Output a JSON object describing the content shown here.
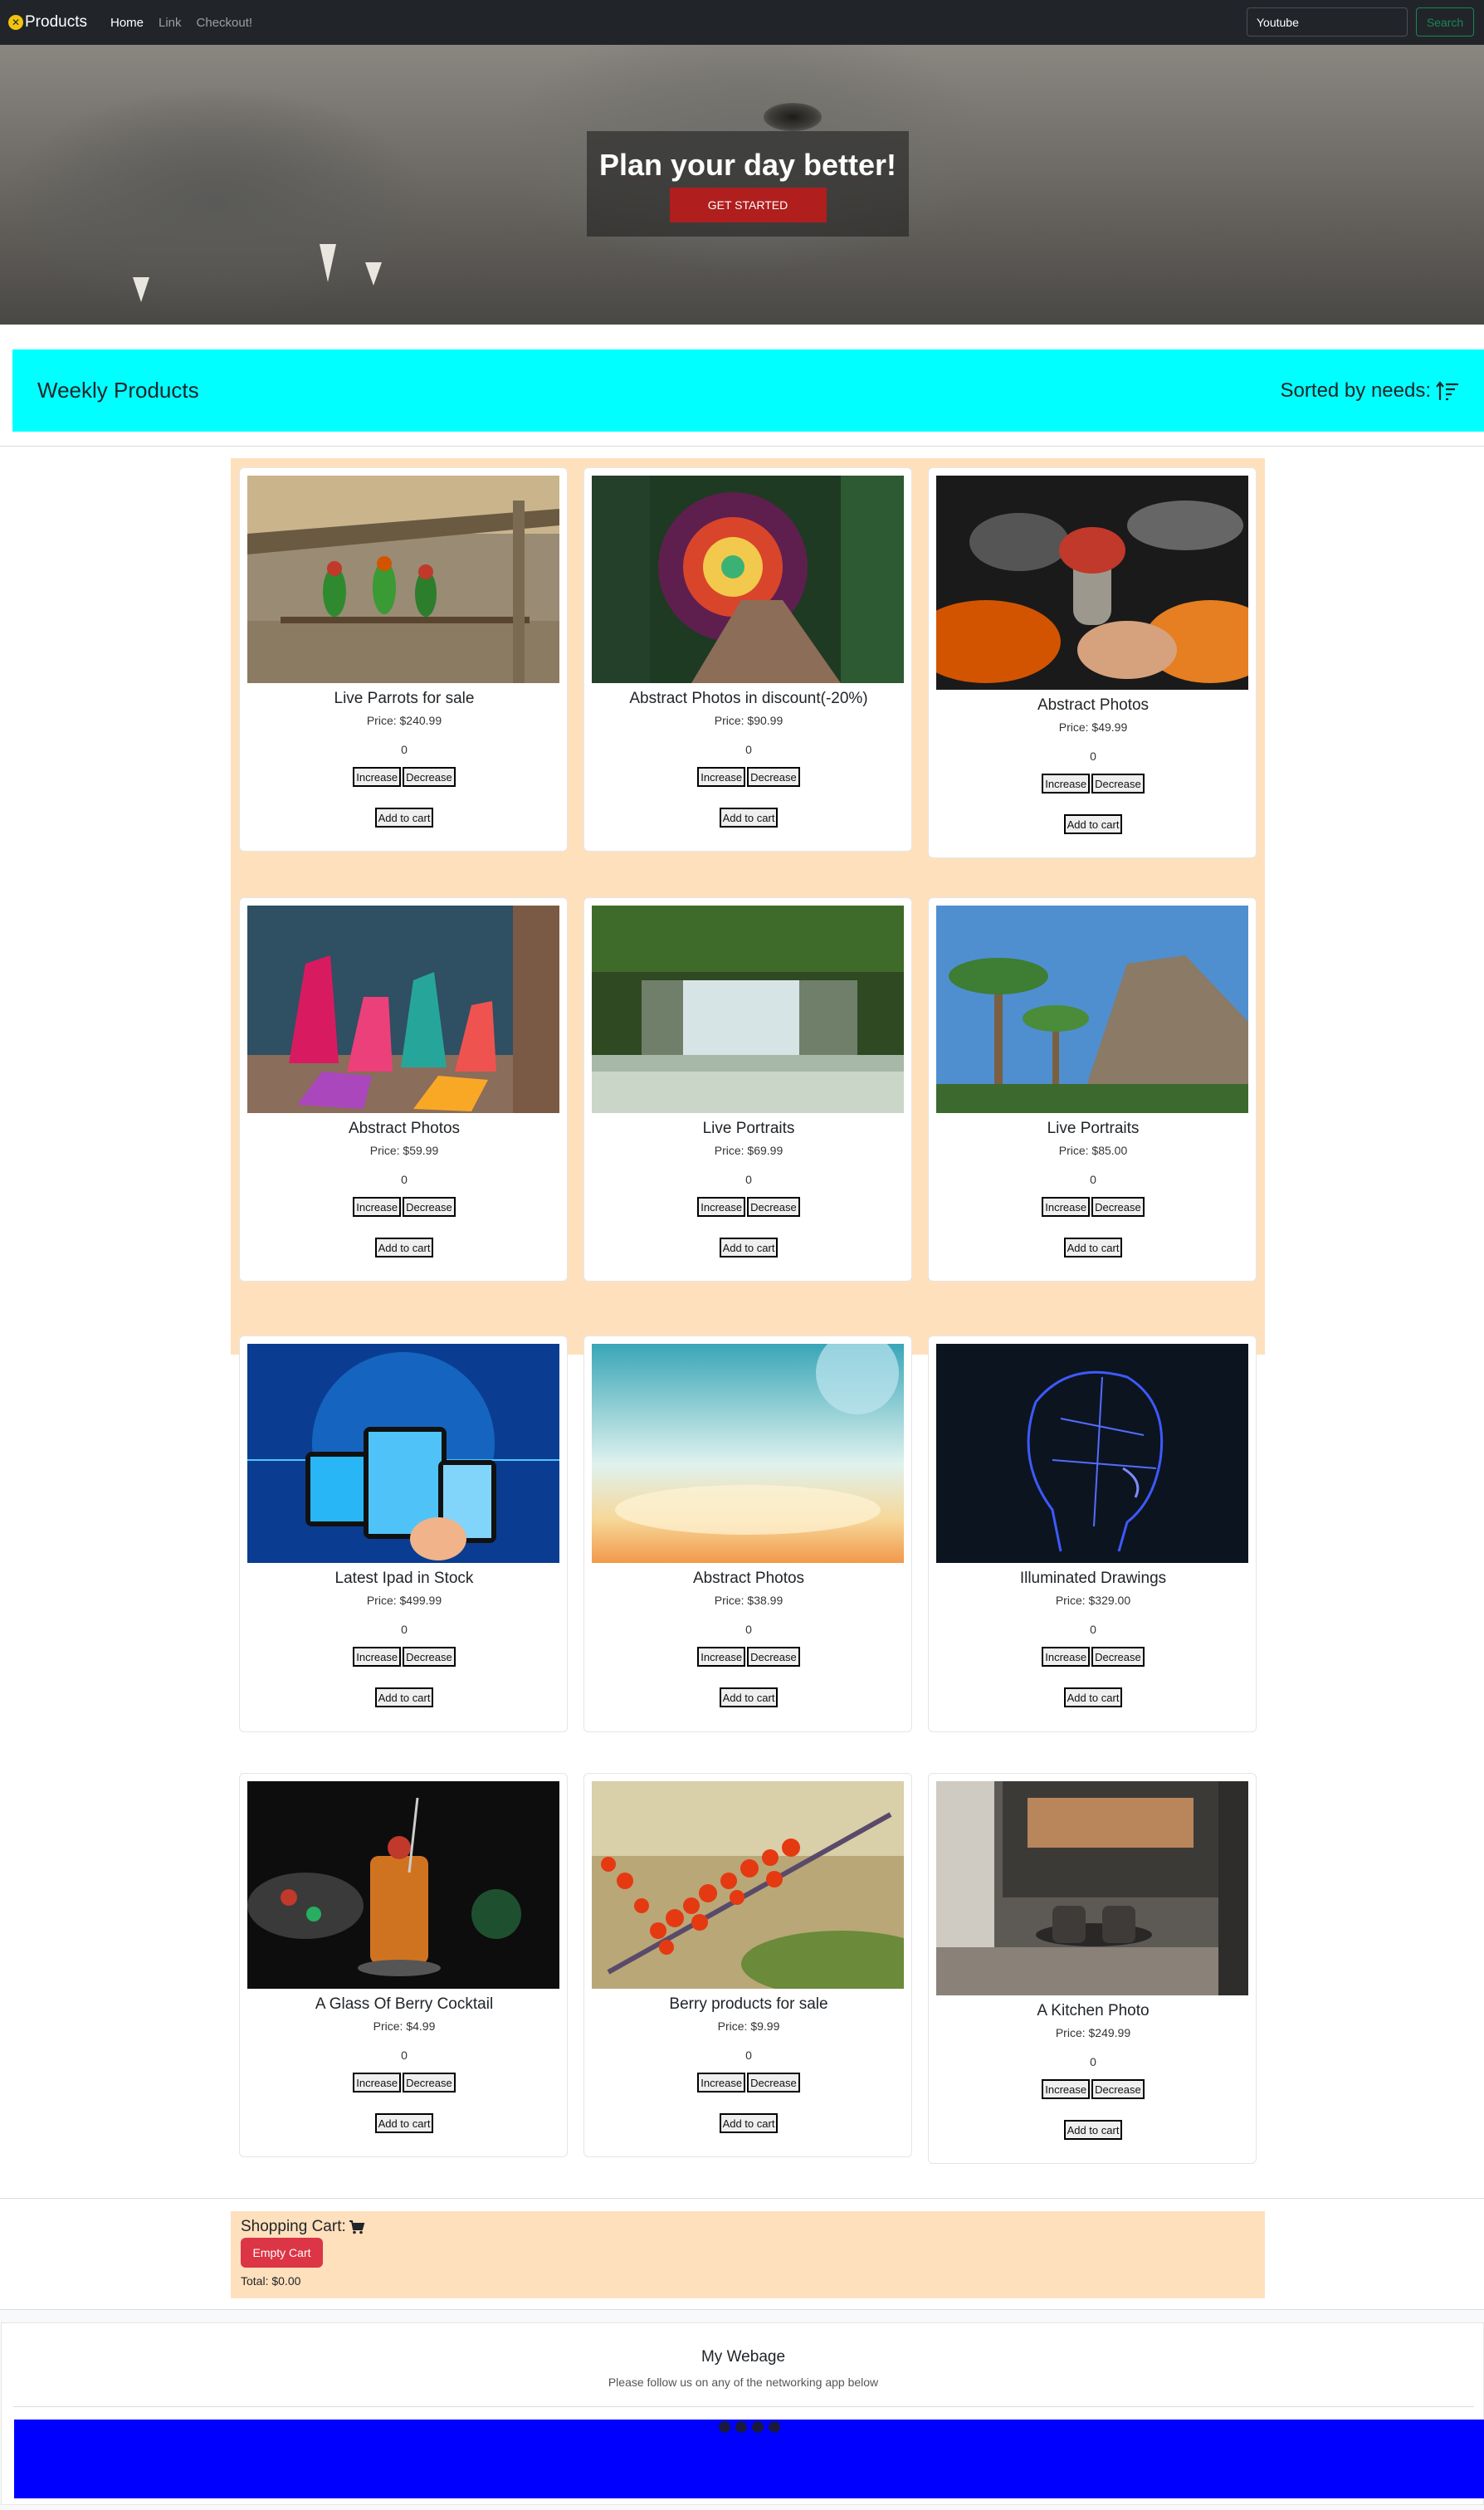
{
  "navbar": {
    "brand": "Products",
    "links": [
      "Home",
      "Link",
      "Checkout!"
    ],
    "search_value": "Youtube",
    "search_button": "Search"
  },
  "hero": {
    "title": "Plan your day better!",
    "button": "GET STARTED"
  },
  "weekly": {
    "title": "Weekly Products",
    "sort_label": "Sorted by needs:"
  },
  "products": [
    {
      "name": "Live Parrots for sale",
      "price": "Price: $240.99",
      "qty": "0",
      "image": "parrots"
    },
    {
      "name": "Abstract Photos in discount(-20%)",
      "price": "Price: $90.99",
      "qty": "0",
      "image": "stained-glass-path"
    },
    {
      "name": "Abstract Photos",
      "price": "Price: $49.99",
      "qty": "0",
      "image": "mushroom-fire"
    },
    {
      "name": "Abstract Photos",
      "price": "Price: $59.99",
      "qty": "0",
      "image": "crystals"
    },
    {
      "name": "Live Portraits",
      "price": "Price: $69.99",
      "qty": "0",
      "image": "waterfall"
    },
    {
      "name": "Live Portraits",
      "price": "Price: $85.00",
      "qty": "0",
      "image": "palm-mountain"
    },
    {
      "name": "Latest Ipad in Stock",
      "price": "Price: $499.99",
      "qty": "0",
      "image": "tablets"
    },
    {
      "name": "Abstract Photos",
      "price": "Price: $38.99",
      "qty": "0",
      "image": "sunburst"
    },
    {
      "name": "Illuminated Drawings",
      "price": "Price: $329.00",
      "qty": "0",
      "image": "neon-head"
    },
    {
      "name": "A Glass Of Berry Cocktail",
      "price": "Price: $4.99",
      "qty": "0",
      "image": "cocktail"
    },
    {
      "name": "Berry products for sale",
      "price": "Price: $9.99",
      "qty": "0",
      "image": "red-berries"
    },
    {
      "name": "A Kitchen Photo",
      "price": "Price: $249.99",
      "qty": "0",
      "image": "kitchen"
    }
  ],
  "buttons": {
    "increase": "Increase",
    "decrease": "Decrease",
    "add_to_cart": "Add to cart"
  },
  "cart": {
    "title": "Shopping Cart:",
    "empty_button": "Empty Cart",
    "total": "Total: $0.00"
  },
  "footer": {
    "title": "My Webage",
    "subtitle": "Please follow us on any of the networking app below"
  },
  "colors": {
    "navbar": "#212529",
    "weekly_bar": "#00ffff",
    "product_area": "#ffe0bd",
    "social_band": "#0000ff",
    "empty_cart": "#dc3545",
    "hero_button": "#b01e1e"
  }
}
